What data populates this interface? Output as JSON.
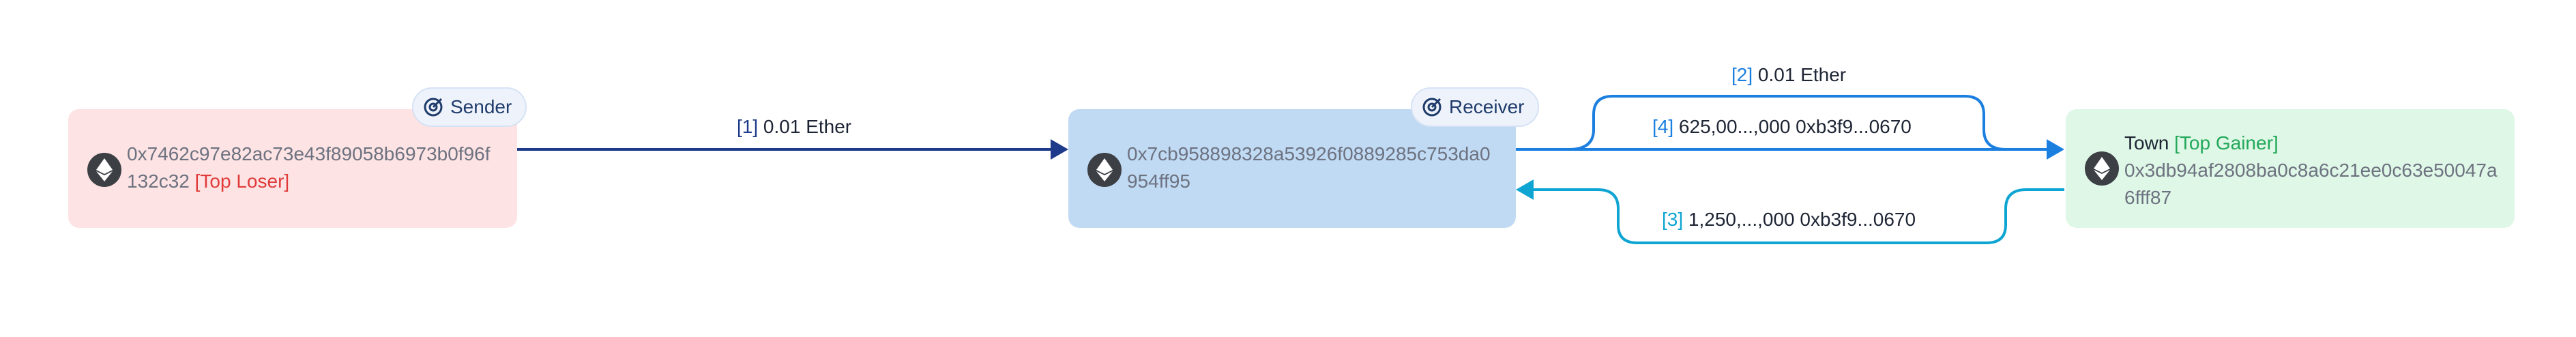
{
  "nodes": {
    "sender": {
      "role": "Sender",
      "address": "0x7462c97e82ac73e43f89058b6973b0f96f132c32",
      "tag": "[Top Loser]"
    },
    "receiver": {
      "role": "Receiver",
      "address": "0x7cb958898328a53926f0889285c753da0954ff95"
    },
    "town": {
      "name": "Town",
      "tag": "[Top Gainer]",
      "address": "0x3db94af2808ba0c8a6c21ee0c63e50047a6fff87"
    }
  },
  "edges": [
    {
      "index": "[1]",
      "amount": "0.01 Ether"
    },
    {
      "index": "[2]",
      "amount": "0.01 Ether"
    },
    {
      "index": "[3]",
      "amount": "1,250,...,000  0xb3f9...0670"
    },
    {
      "index": "[4]",
      "amount": "625,00...,000  0xb3f9...0670"
    }
  ],
  "colors": {
    "sender_bg": "#fde3e3",
    "receiver_bg": "#c0daf4",
    "town_bg": "#dff7e6",
    "top_loser": "#e03a3a",
    "top_gainer": "#22a85a",
    "edge_navy": "#1e3a8a",
    "edge_blue": "#1b7fe0",
    "edge_cyan": "#0ea5d3"
  },
  "icons": [
    "ethereum-icon",
    "target-icon",
    "arrowhead"
  ]
}
